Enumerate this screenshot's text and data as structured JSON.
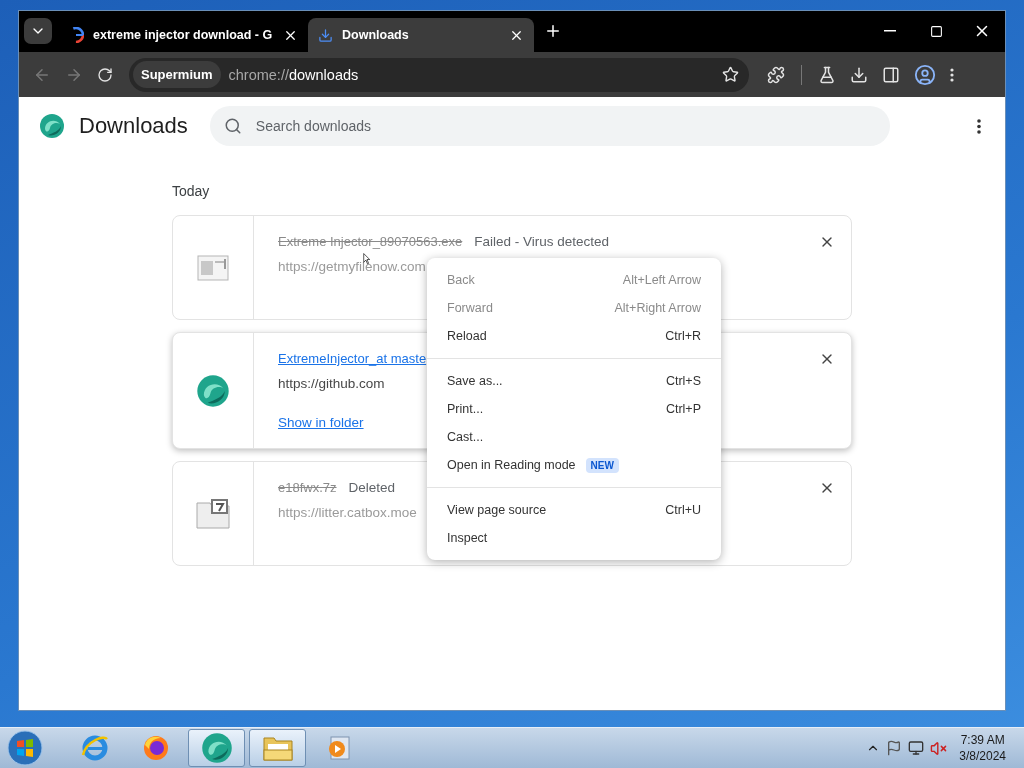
{
  "tabs": [
    {
      "title": "extreme injector download - G",
      "kind": "google",
      "selected": false
    },
    {
      "title": "Downloads",
      "kind": "download",
      "selected": true
    }
  ],
  "omnibox": {
    "chip": "Supermium",
    "url_scheme": "chrome://",
    "url_path": "downloads"
  },
  "page": {
    "title": "Downloads",
    "search": {
      "placeholder": "Search downloads"
    },
    "section": "Today"
  },
  "downloads": [
    {
      "kind": "failed",
      "file": "Extreme Injector_89070563.exe",
      "status": "Failed - Virus detected",
      "url": "https://getmyfilenow.com",
      "highlighted": false
    },
    {
      "kind": "complete",
      "file": "ExtremeInjector_at maste",
      "url": "https://github.com",
      "action": "Show in folder",
      "highlighted": true
    },
    {
      "kind": "deleted",
      "file": "e18fwx.7z",
      "status": "Deleted",
      "url": "https://litter.catbox.moe",
      "highlighted": false
    }
  ],
  "context_menu": [
    [
      {
        "label": "Back",
        "shortcut": "Alt+Left Arrow",
        "disabled": true
      },
      {
        "label": "Forward",
        "shortcut": "Alt+Right Arrow",
        "disabled": true
      },
      {
        "label": "Reload",
        "shortcut": "Ctrl+R",
        "disabled": false
      }
    ],
    [
      {
        "label": "Save as...",
        "shortcut": "Ctrl+S",
        "disabled": false
      },
      {
        "label": "Print...",
        "shortcut": "Ctrl+P",
        "disabled": false
      },
      {
        "label": "Cast...",
        "disabled": false
      },
      {
        "label": "Open in Reading mode",
        "badge": "NEW",
        "disabled": false
      }
    ],
    [
      {
        "label": "View page source",
        "shortcut": "Ctrl+U",
        "disabled": false
      },
      {
        "label": "Inspect",
        "disabled": false
      }
    ]
  ],
  "taskbar": [
    {
      "kind": "ie",
      "running": false
    },
    {
      "kind": "firefox",
      "running": false
    },
    {
      "kind": "supermium",
      "running": true
    },
    {
      "kind": "explorer",
      "running": true
    },
    {
      "kind": "media",
      "running": false
    }
  ],
  "clock": {
    "time": "7:39 AM",
    "date": "3/8/2024"
  }
}
